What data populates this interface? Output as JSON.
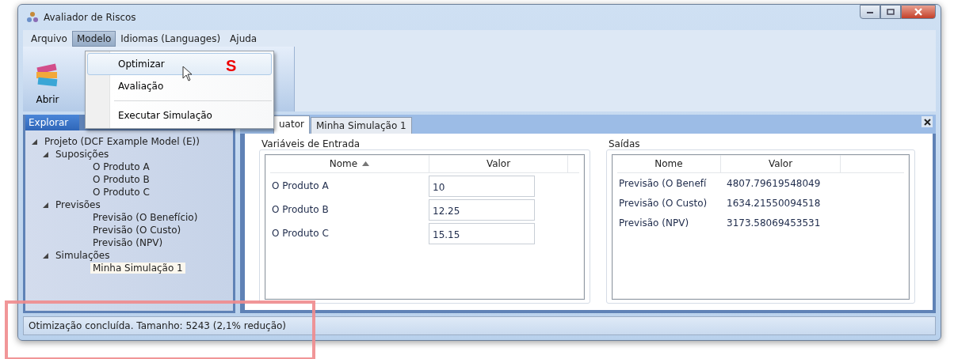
{
  "window": {
    "title": "Avaliador de Riscos"
  },
  "menu_bar": [
    {
      "label": "Arquivo",
      "selected": false
    },
    {
      "label": "Modelo",
      "selected": true
    },
    {
      "label": "Idiomas (Languages)",
      "selected": false
    },
    {
      "label": "Ajuda",
      "selected": false
    }
  ],
  "dropdown": {
    "items": [
      {
        "kind": "item",
        "label": "Optimizar",
        "highlighted": true
      },
      {
        "kind": "item",
        "label": "Avaliação",
        "highlighted": false
      },
      {
        "kind": "separator"
      },
      {
        "kind": "item",
        "label": "Executar Simulação",
        "highlighted": false
      }
    ]
  },
  "annotation": {
    "text": "S"
  },
  "toolbar": {
    "buttons": [
      {
        "label": "Abrir"
      }
    ]
  },
  "explorer": {
    "title": "Explorar",
    "tree": [
      {
        "label": "Projeto (DCF Example Model (E))",
        "expanded": true,
        "selected": false,
        "children": [
          {
            "label": "Suposições",
            "expanded": true,
            "selected": false,
            "children": [
              {
                "label": "O Produto A",
                "selected": false
              },
              {
                "label": "O Produto B",
                "selected": false
              },
              {
                "label": "O Produto C",
                "selected": false
              }
            ]
          },
          {
            "label": "Previsões",
            "expanded": true,
            "selected": false,
            "children": [
              {
                "label": "Previsão (O Benefício)",
                "selected": false
              },
              {
                "label": "Previsão (O Custo)",
                "selected": false
              },
              {
                "label": "Previsão (NPV)",
                "selected": false
              }
            ]
          },
          {
            "label": "Simulações",
            "expanded": true,
            "selected": false,
            "children": [
              {
                "label": "Minha Simulação 1",
                "selected": true
              }
            ]
          }
        ]
      }
    ]
  },
  "tabs": [
    {
      "label": "uator",
      "selected": true
    },
    {
      "label": "Minha Simulação 1",
      "selected": false
    }
  ],
  "inputs": {
    "title": "Variáveis de Entrada",
    "columns": [
      {
        "label": "Nome",
        "sorted": true
      },
      {
        "label": "Valor",
        "sorted": false
      }
    ],
    "rows": [
      {
        "name": "O Produto A",
        "value": "10"
      },
      {
        "name": "O Produto B",
        "value": "12.25"
      },
      {
        "name": "O Produto C",
        "value": "15.15"
      }
    ]
  },
  "outputs": {
    "title": "Saídas",
    "columns": [
      {
        "label": "Nome",
        "sorted": false
      },
      {
        "label": "Valor",
        "sorted": false
      }
    ],
    "rows": [
      {
        "name": "Previsão (O Benefí",
        "value": "4807.79619548049"
      },
      {
        "name": "Previsão (O Custo)",
        "value": "1634.21550094518"
      },
      {
        "name": "Previsão (NPV)",
        "value": "3173.58069453531"
      }
    ]
  },
  "status_bar": {
    "text": "Otimização concluída. Tamanho: 5243 (2,1% redução)",
    "highlighted": true
  }
}
